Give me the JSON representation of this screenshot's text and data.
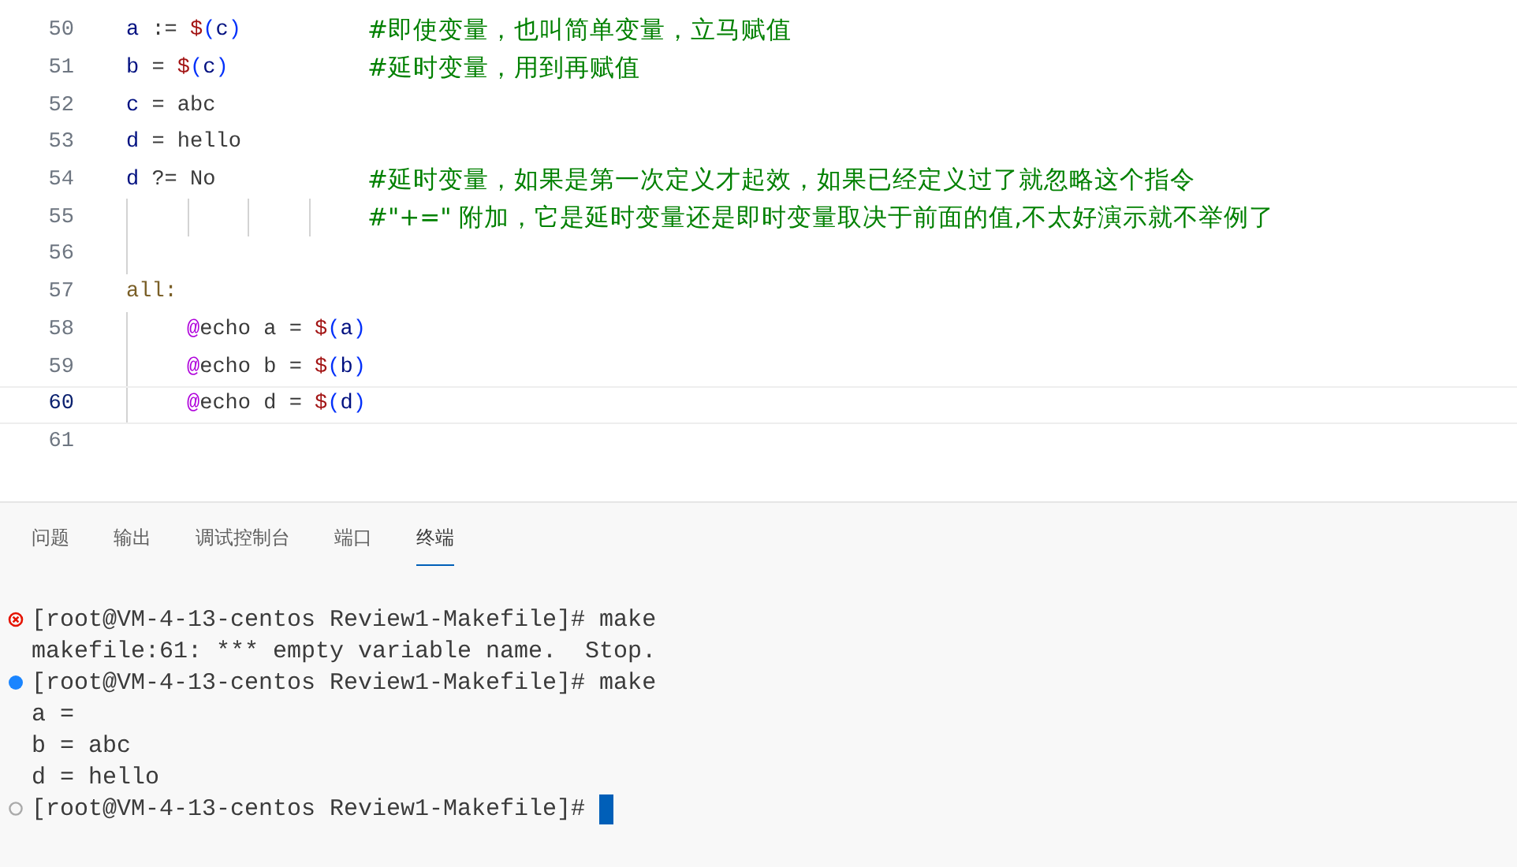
{
  "editor": {
    "lines": [
      {
        "number": "50",
        "code": [
          {
            "kind": "name",
            "text": "a"
          },
          {
            "kind": "plain",
            "text": " := "
          },
          {
            "kind": "dollar",
            "text": "$"
          },
          {
            "kind": "bracket",
            "text": "("
          },
          {
            "kind": "name",
            "text": "c"
          },
          {
            "kind": "bracket",
            "text": ")"
          }
        ],
        "comment": "#即使变量，也叫简单变量，立马赋值"
      },
      {
        "number": "51",
        "code": [
          {
            "kind": "name",
            "text": "b"
          },
          {
            "kind": "plain",
            "text": " = "
          },
          {
            "kind": "dollar",
            "text": "$"
          },
          {
            "kind": "bracket",
            "text": "("
          },
          {
            "kind": "name",
            "text": "c"
          },
          {
            "kind": "bracket",
            "text": ")"
          }
        ],
        "comment": "#延时变量，用到再赋值"
      },
      {
        "number": "52",
        "code": [
          {
            "kind": "name",
            "text": "c"
          },
          {
            "kind": "plain",
            "text": " = abc"
          }
        ]
      },
      {
        "number": "53",
        "code": [
          {
            "kind": "name",
            "text": "d"
          },
          {
            "kind": "plain",
            "text": " = hello"
          }
        ]
      },
      {
        "number": "54",
        "code": [
          {
            "kind": "name",
            "text": "d"
          },
          {
            "kind": "plain",
            "text": " ?= No"
          }
        ],
        "comment": "#延时变量，如果是第一次定义才起效，如果已经定义过了就忽略这个指令"
      },
      {
        "number": "55",
        "indent": [
          {
            "kind": "guide"
          },
          {
            "kind": "guide"
          },
          {
            "kind": "guide"
          },
          {
            "kind": "guide"
          }
        ],
        "comment": "#\"+=\" 附加，它是延时变量还是即时变量取决于前面的值,不太好演示就不举例了"
      },
      {
        "number": "56",
        "indent": [
          {
            "kind": "guide"
          }
        ]
      },
      {
        "number": "57",
        "code": [
          {
            "kind": "target",
            "text": "all:"
          }
        ]
      },
      {
        "number": "58",
        "indent": [
          {
            "kind": "guide"
          }
        ],
        "code": [
          {
            "kind": "at",
            "text": "@"
          },
          {
            "kind": "plain",
            "text": "echo a = "
          },
          {
            "kind": "dollar",
            "text": "$"
          },
          {
            "kind": "bracket",
            "text": "("
          },
          {
            "kind": "name",
            "text": "a"
          },
          {
            "kind": "bracket",
            "text": ")"
          }
        ]
      },
      {
        "number": "59",
        "indent": [
          {
            "kind": "guide"
          }
        ],
        "code": [
          {
            "kind": "at",
            "text": "@"
          },
          {
            "kind": "plain",
            "text": "echo b = "
          },
          {
            "kind": "dollar",
            "text": "$"
          },
          {
            "kind": "bracket",
            "text": "("
          },
          {
            "kind": "name",
            "text": "b"
          },
          {
            "kind": "bracket",
            "text": ")"
          }
        ]
      },
      {
        "number": "60",
        "current": true,
        "indent": [
          {
            "kind": "guide"
          }
        ],
        "code": [
          {
            "kind": "at",
            "text": "@"
          },
          {
            "kind": "plain",
            "text": "echo d = "
          },
          {
            "kind": "dollar",
            "text": "$"
          },
          {
            "kind": "bracket",
            "text": "("
          },
          {
            "kind": "name",
            "text": "d"
          },
          {
            "kind": "bracket",
            "text": ")"
          }
        ]
      },
      {
        "number": "61"
      }
    ]
  },
  "panel": {
    "tabs": [
      {
        "label": "问题",
        "selected": false
      },
      {
        "label": "输出",
        "selected": false
      },
      {
        "label": "调试控制台",
        "selected": false
      },
      {
        "label": "端口",
        "selected": false
      },
      {
        "label": "终端",
        "selected": true
      }
    ],
    "terminal": [
      {
        "kind": "command_error",
        "text": "[root@VM-4-13-centos Review1-Makefile]# make"
      },
      {
        "kind": "output",
        "text": "makefile:61: *** empty variable name.  Stop."
      },
      {
        "kind": "command_success",
        "text": "[root@VM-4-13-centos Review1-Makefile]# make"
      },
      {
        "kind": "output",
        "text": "a ="
      },
      {
        "kind": "output",
        "text": "b = abc"
      },
      {
        "kind": "output",
        "text": "d = hello"
      },
      {
        "kind": "command_idle",
        "text": "[root@VM-4-13-centos Review1-Makefile]#",
        "cursor": true
      }
    ]
  }
}
